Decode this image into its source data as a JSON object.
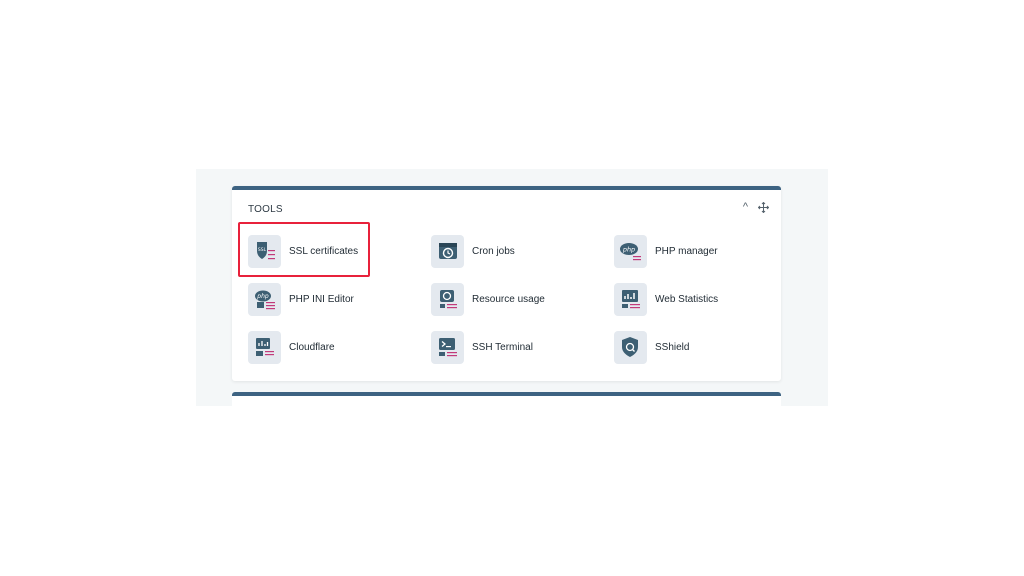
{
  "panel": {
    "title": "TOOLS",
    "collapse_glyph": "^",
    "move_icon": "move-icon"
  },
  "tools": [
    {
      "label": "SSL certificates",
      "icon": "ssl-icon",
      "highlighted": true
    },
    {
      "label": "Cron jobs",
      "icon": "cron-clock-icon"
    },
    {
      "label": "PHP manager",
      "icon": "php-icon"
    },
    {
      "label": "PHP INI Editor",
      "icon": "php-ini-icon"
    },
    {
      "label": "Resource usage",
      "icon": "resource-gauge-icon"
    },
    {
      "label": "Web Statistics",
      "icon": "web-statistics-icon"
    },
    {
      "label": "Cloudflare",
      "icon": "cloudflare-icon"
    },
    {
      "label": "SSH Terminal",
      "icon": "terminal-icon"
    },
    {
      "label": "SShield",
      "icon": "shield-icon"
    }
  ],
  "colors": {
    "panel_accent": "#3d6382",
    "icon_tile": "#e4e9ef",
    "icon_dark": "#3d5f73",
    "icon_line_accent": "#c23a7a",
    "highlight": "#e8213b"
  }
}
